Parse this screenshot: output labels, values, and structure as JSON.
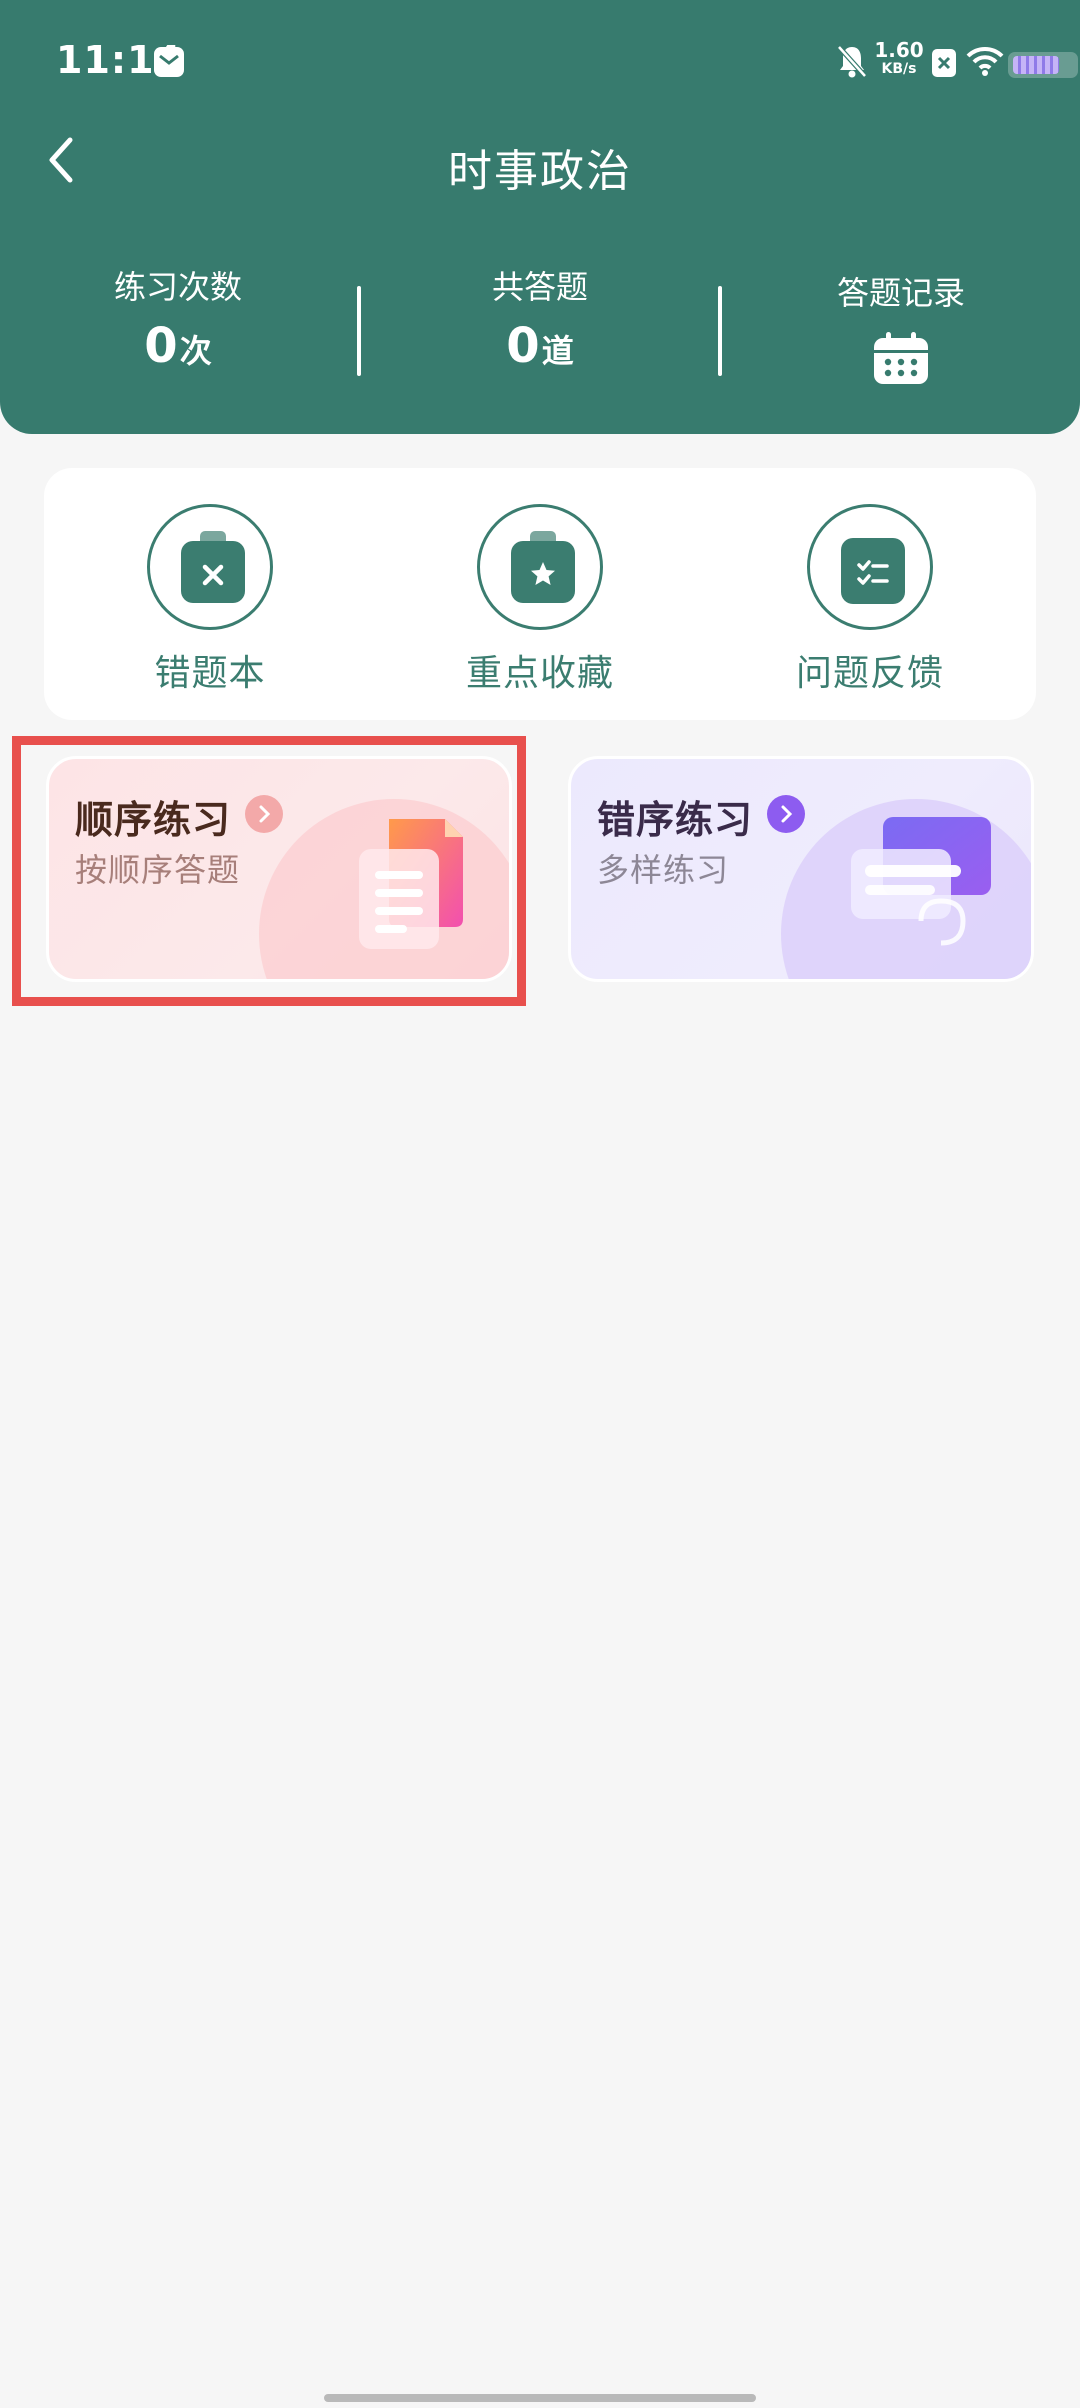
{
  "status_bar": {
    "time": "11:14",
    "net_speed_value": "1.60",
    "net_speed_unit": "KB/s"
  },
  "nav": {
    "title": "时事政治"
  },
  "stats": {
    "practice_count": {
      "label": "练习次数",
      "value": "0",
      "unit": "次"
    },
    "total_answered": {
      "label": "共答题",
      "value": "0",
      "unit": "道"
    },
    "answer_record": {
      "label": "答题记录"
    }
  },
  "tools": [
    {
      "label": "错题本",
      "icon": "x-clipboard-icon"
    },
    {
      "label": "重点收藏",
      "icon": "star-clipboard-icon"
    },
    {
      "label": "问题反馈",
      "icon": "checklist-icon"
    }
  ],
  "practice_cards": [
    {
      "title": "顺序练习",
      "subtitle": "按顺序答题",
      "icon": "document-icon",
      "highlighted": true
    },
    {
      "title": "错序练习",
      "subtitle": "多样练习",
      "icon": "card-stack-icon",
      "highlighted": false
    }
  ],
  "colors": {
    "primary": "#377b6e",
    "tool_accent": "#3b7d70",
    "highlight": "#e8504d",
    "background": "#f6f6f6"
  }
}
